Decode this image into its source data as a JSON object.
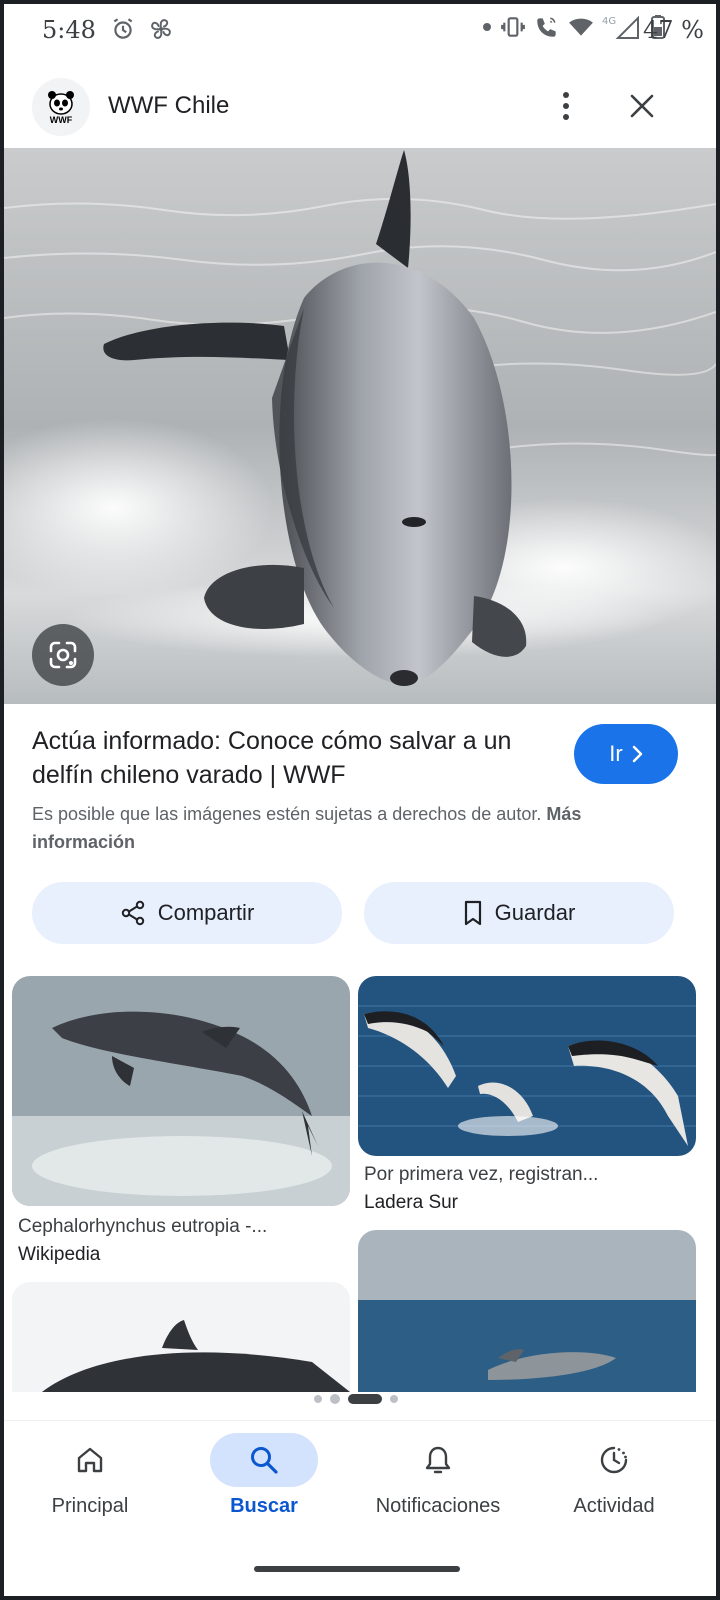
{
  "status_bar": {
    "time": "5:48",
    "battery": "47 %",
    "network": "4G"
  },
  "header": {
    "site_name": "WWF Chile",
    "logo_text": "WWF"
  },
  "result": {
    "title": "Actúa informado: Conoce cómo salvar a un delfín chileno varado | WWF",
    "go_label": "Ir",
    "copyright_text": "Es posible que las imágenes estén sujetas a derechos de autor.",
    "more_info_label": "Más información"
  },
  "actions": {
    "share_label": "Compartir",
    "save_label": "Guardar"
  },
  "related": [
    {
      "title": "Cephalorhynchus eutropia -...",
      "source": "Wikipedia"
    },
    {
      "title": "Por primera vez, registran...",
      "source": "Ladera Sur"
    }
  ],
  "bottom_nav": {
    "items": [
      {
        "label": "Principal",
        "icon": "home-icon"
      },
      {
        "label": "Buscar",
        "icon": "search-icon"
      },
      {
        "label": "Notificaciones",
        "icon": "bell-icon"
      },
      {
        "label": "Actividad",
        "icon": "activity-icon"
      }
    ],
    "active_index": 1
  },
  "colors": {
    "accent": "#1a73e8",
    "button_bg": "#e8f0fe",
    "nav_active_pill": "#d3e3fd",
    "nav_active_text": "#0b57d0"
  }
}
